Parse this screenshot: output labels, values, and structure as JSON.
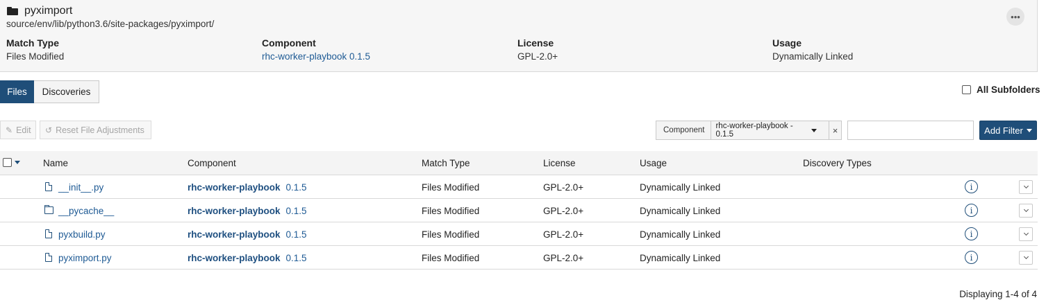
{
  "header": {
    "folder_name": "pyximport",
    "path": "source/env/lib/python3.6/site-packages/pyximport/",
    "more_label": "•••",
    "meta": [
      {
        "label": "Match Type",
        "value": "Files Modified"
      },
      {
        "label": "Component",
        "value": "rhc-worker-playbook 0.1.5"
      },
      {
        "label": "License",
        "value": "GPL-2.0+"
      },
      {
        "label": "Usage",
        "value": "Dynamically Linked"
      }
    ]
  },
  "tabs": {
    "files": "Files",
    "discoveries": "Discoveries",
    "active": "Files"
  },
  "all_subfolders": {
    "label": "All Subfolders",
    "checked": false
  },
  "toolbar": {
    "edit": "Edit",
    "reset": "Reset File Adjustments"
  },
  "filter": {
    "key": "Component",
    "value": "rhc-worker-playbook - 0.1.5",
    "clear": "×",
    "search_value": "",
    "add_filter": "Add Filter"
  },
  "table": {
    "columns": [
      "Name",
      "Component",
      "Match Type",
      "License",
      "Usage",
      "Discovery Types"
    ],
    "rows": [
      {
        "icon": "file-icon",
        "name": "__init__.py",
        "component": "rhc-worker-playbook",
        "version": "0.1.5",
        "match_type": "Files Modified",
        "license": "GPL-2.0+",
        "usage": "Dynamically Linked",
        "discovery_types": ""
      },
      {
        "icon": "folder-icon",
        "name": "__pycache__",
        "component": "rhc-worker-playbook",
        "version": "0.1.5",
        "match_type": "Files Modified",
        "license": "GPL-2.0+",
        "usage": "Dynamically Linked",
        "discovery_types": ""
      },
      {
        "icon": "file-icon",
        "name": "pyxbuild.py",
        "component": "rhc-worker-playbook",
        "version": "0.1.5",
        "match_type": "Files Modified",
        "license": "GPL-2.0+",
        "usage": "Dynamically Linked",
        "discovery_types": ""
      },
      {
        "icon": "file-icon",
        "name": "pyximport.py",
        "component": "rhc-worker-playbook",
        "version": "0.1.5",
        "match_type": "Files Modified",
        "license": "GPL-2.0+",
        "usage": "Dynamically Linked",
        "discovery_types": ""
      }
    ]
  },
  "footer": {
    "displaying": "Displaying 1-4 of 4"
  },
  "colors": {
    "primary": "#1f4e79",
    "link": "#1e5a94",
    "header_bg": "#f6f6f6"
  }
}
